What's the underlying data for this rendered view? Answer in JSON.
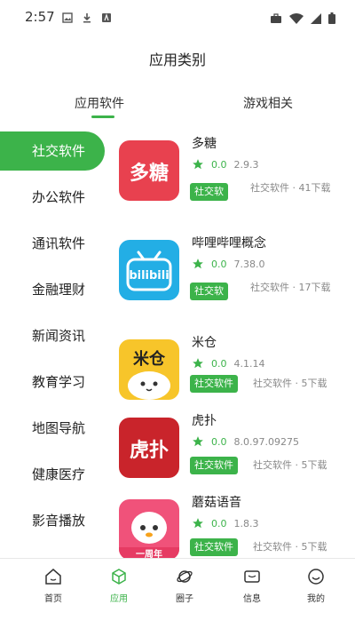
{
  "status_bar": {
    "time": "2:57"
  },
  "header": {
    "title": "应用类别"
  },
  "tabs": [
    {
      "label": "应用软件",
      "active": true
    },
    {
      "label": "游戏相关",
      "active": false
    }
  ],
  "sidebar": {
    "items": [
      {
        "label": "社交软件",
        "active": true
      },
      {
        "label": "办公软件"
      },
      {
        "label": "通讯软件"
      },
      {
        "label": "金融理财"
      },
      {
        "label": "新闻资讯"
      },
      {
        "label": "教育学习"
      },
      {
        "label": "地图导航"
      },
      {
        "label": "健康医疗"
      },
      {
        "label": "影音播放"
      }
    ]
  },
  "apps": [
    {
      "name": "多糖",
      "rating": "0.0",
      "version": "2.9.3",
      "tag": "社交软",
      "meta": "社交软件 · 41下载",
      "icon_text": "多糖",
      "icon": "duotang-logo"
    },
    {
      "name": "哔哩哔哩概念",
      "rating": "0.0",
      "version": "7.38.0",
      "tag": "社交软",
      "meta": "社交软件 · 17下载",
      "icon_text": "bilibili",
      "icon": "bilibili-logo"
    },
    {
      "name": "米仓",
      "rating": "0.0",
      "version": "4.1.14",
      "tag": "社交软件",
      "meta": "社交软件 · 5下载",
      "icon_text": "米仓",
      "icon": "micang-logo"
    },
    {
      "name": "虎扑",
      "rating": "0.0",
      "version": "8.0.97.09275",
      "tag": "社交软件",
      "meta": "社交软件 · 5下载",
      "icon_text": "虎扑",
      "icon": "hupu-logo"
    },
    {
      "name": "蘑菇语音",
      "rating": "0.0",
      "version": "1.8.3",
      "tag": "社交软件",
      "meta": "社交软件 · 5下载",
      "icon_text": "一周年",
      "icon": "mogu-logo"
    }
  ],
  "bottom_nav": [
    {
      "label": "首页",
      "icon": "home-icon"
    },
    {
      "label": "应用",
      "icon": "apps-cube-icon",
      "active": true
    },
    {
      "label": "圈子",
      "icon": "planet-icon"
    },
    {
      "label": "信息",
      "icon": "message-icon"
    },
    {
      "label": "我的",
      "icon": "profile-icon"
    }
  ],
  "colors": {
    "accent": "#3cb34a",
    "star": "#3cb34a"
  }
}
